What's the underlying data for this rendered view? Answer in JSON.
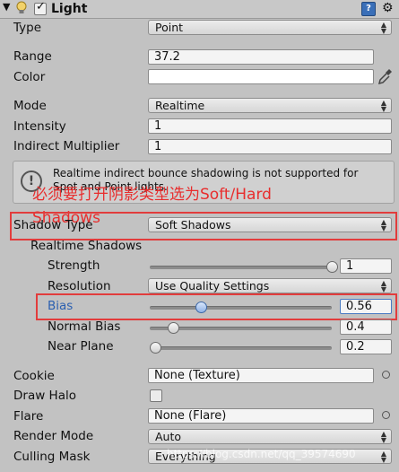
{
  "header": {
    "title": "Light",
    "enabled": true
  },
  "fields": {
    "type": {
      "label": "Type",
      "value": "Point"
    },
    "range": {
      "label": "Range",
      "value": "37.2"
    },
    "color": {
      "label": "Color",
      "value": "#ffffff"
    },
    "mode": {
      "label": "Mode",
      "value": "Realtime"
    },
    "intensity": {
      "label": "Intensity",
      "value": "1"
    },
    "indirect": {
      "label": "Indirect Multiplier",
      "value": "1"
    },
    "shadow_type": {
      "label": "Shadow Type",
      "value": "Soft Shadows"
    },
    "realtime_shadows": {
      "label": "Realtime Shadows"
    },
    "strength": {
      "label": "Strength",
      "value": "1",
      "level": 1.0
    },
    "resolution": {
      "label": "Resolution",
      "value": "Use Quality Settings"
    },
    "bias": {
      "label": "Bias",
      "value": "0.56",
      "level": 0.28
    },
    "normal_bias": {
      "label": "Normal Bias",
      "value": "0.4",
      "level": 0.13
    },
    "near_plane": {
      "label": "Near Plane",
      "value": "0.2",
      "level": 0.03
    },
    "cookie": {
      "label": "Cookie",
      "value": "None (Texture)"
    },
    "draw_halo": {
      "label": "Draw Halo",
      "checked": false
    },
    "flare": {
      "label": "Flare",
      "value": "None (Flare)"
    },
    "render_mode": {
      "label": "Render Mode",
      "value": "Auto"
    },
    "culling_mask": {
      "label": "Culling Mask",
      "value": "Everything"
    }
  },
  "warning": {
    "line1": "Realtime indirect bounce shadowing is not supported for",
    "line2": "Spot and Point lights."
  },
  "annotation": {
    "line1": "必须要打开阴影类型选为Soft/Hard",
    "line2": "Shadows"
  },
  "watermark": "https://blog.csdn.net/qq_39574690",
  "icons": {
    "fold": "fold-arrow-icon",
    "bulb": "light-bulb-icon",
    "help": "help-book-icon",
    "gear": "gear-icon",
    "warn": "warning-icon",
    "eyedrop": "eyedropper-icon",
    "picker": "object-picker-icon"
  },
  "colors": {
    "annotation_red": "#e23c3c",
    "bias_label": "#2b5fb0"
  }
}
